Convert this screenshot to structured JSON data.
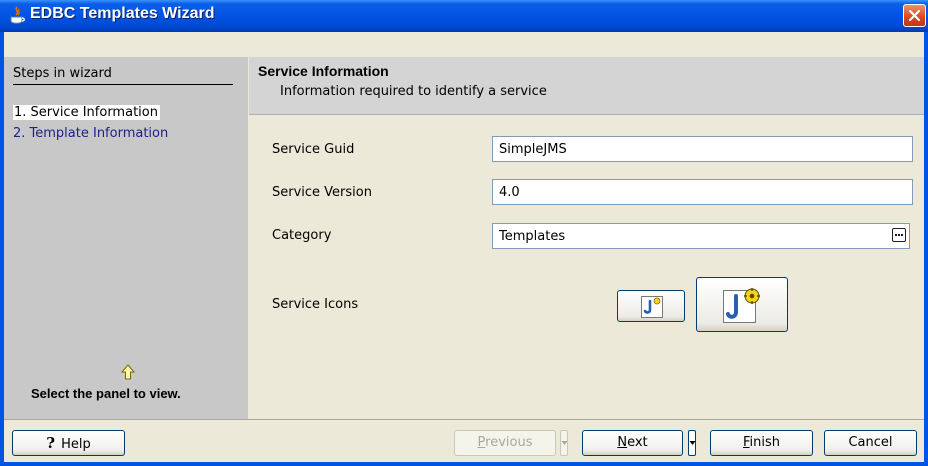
{
  "window": {
    "title": "EDBC Templates Wizard"
  },
  "steps": {
    "header": "Steps in wizard",
    "items": [
      "1. Service Information",
      "2. Template Information"
    ],
    "hint": "Select the panel to view."
  },
  "panel": {
    "title": "Service Information",
    "subtitle": "Information required to identify a service"
  },
  "form": {
    "service_guid_label": "Service Guid",
    "service_guid_value": "SimpleJMS",
    "service_version_label": "Service Version",
    "service_version_value": "4.0",
    "category_label": "Category",
    "category_value": "Templates",
    "service_icons_label": "Service Icons"
  },
  "footer": {
    "help": "Help",
    "previous_mnemonic": "P",
    "previous_rest": "revious",
    "next_mnemonic": "N",
    "next_rest": "ext",
    "finish_mnemonic": "F",
    "finish_rest": "inish",
    "cancel": "Cancel"
  },
  "colors": {
    "title_bar": "#0054e3",
    "steps_panel": "#c8c8c8",
    "selected_step_bg": "#ffffff",
    "step_link": "#1f1e8c",
    "close_button": "#d9441e"
  }
}
